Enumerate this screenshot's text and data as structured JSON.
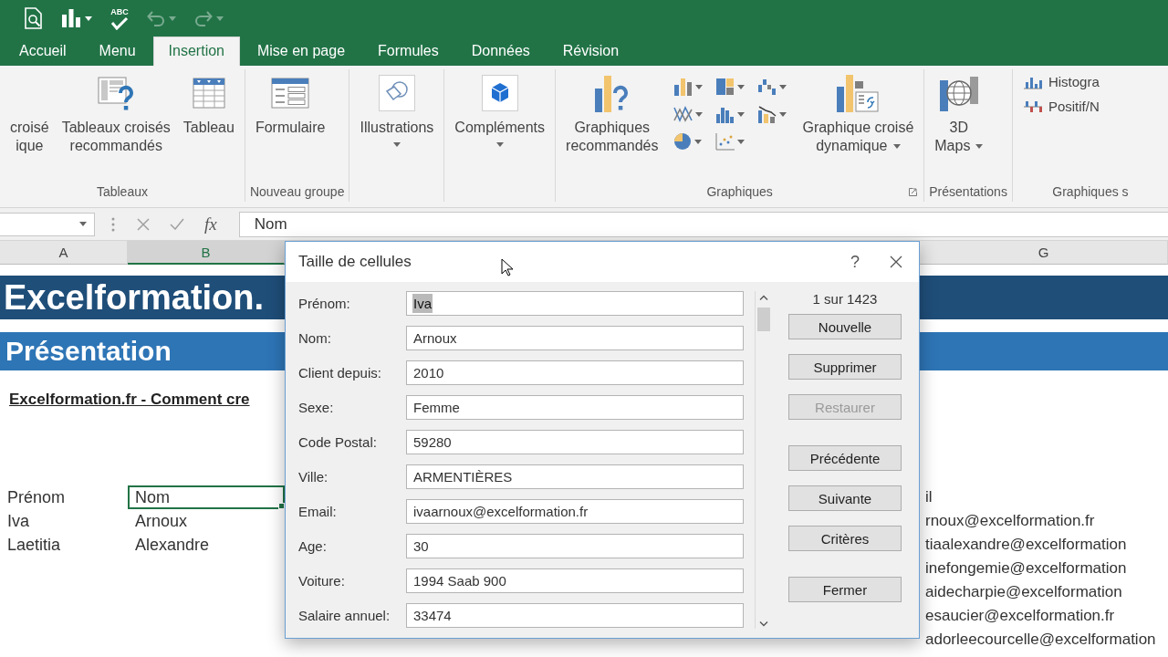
{
  "quick_access": [
    {
      "dropdown": false,
      "disabled": false
    },
    {
      "dropdown": true,
      "disabled": false
    },
    {
      "label": "ABC",
      "dropdown": false,
      "disabled": false
    },
    {
      "dropdown": true,
      "disabled": true
    },
    {
      "dropdown": true,
      "disabled": true
    }
  ],
  "tabs": [
    {
      "label": "Accueil",
      "selected": false
    },
    {
      "label": "Menu",
      "selected": false
    },
    {
      "label": "Insertion",
      "selected": true
    },
    {
      "label": "Mise en page",
      "selected": false
    },
    {
      "label": "Formules",
      "selected": false
    },
    {
      "label": "Données",
      "selected": false
    },
    {
      "label": "Révision",
      "selected": false
    }
  ],
  "ribbon": {
    "groups": [
      {
        "label": "Tableaux",
        "items": [
          {
            "kind": "large",
            "lines": [
              "croisé",
              "ique"
            ],
            "dropdown": false
          },
          {
            "kind": "large",
            "lines": [
              "Tableaux croisés",
              "recommandés"
            ],
            "dropdown": false
          },
          {
            "kind": "large",
            "lines": [
              "Tableau"
            ],
            "dropdown": false
          }
        ]
      },
      {
        "label": "Nouveau groupe",
        "items": [
          {
            "kind": "large",
            "lines": [
              "Formulaire"
            ],
            "dropdown": false
          }
        ]
      },
      {
        "items": [
          {
            "kind": "large",
            "lines": [
              "Illustrations"
            ],
            "dropdown": true
          }
        ]
      },
      {
        "items": [
          {
            "kind": "large",
            "lines": [
              "Compléments"
            ],
            "dropdown": true
          }
        ]
      },
      {
        "label": "Graphiques",
        "launcher": true,
        "items": [
          {
            "kind": "large",
            "lines": [
              "Graphiques",
              "recommandés"
            ],
            "dropdown": false
          },
          {
            "kind": "gallery",
            "items": [
              {
                "dropdown": true
              },
              {
                "dropdown": true
              },
              {
                "dropdown": true
              },
              {
                "dropdown": true
              },
              {
                "dropdown": true
              },
              {
                "dropdown": true
              },
              {
                "dropdown": true
              },
              {
                "dropdown": true
              }
            ]
          },
          {
            "kind": "large",
            "lines": [
              "Graphique croisé",
              "dynamique"
            ],
            "dropdown": true
          }
        ]
      },
      {
        "label": "Présentations",
        "items": [
          {
            "kind": "large",
            "lines": [
              "3D",
              "Maps"
            ],
            "dropdown": true
          }
        ]
      },
      {
        "label": "Graphiques s",
        "items": [
          {
            "kind": "stack",
            "items": [
              {
                "label": "Histogra"
              },
              {
                "label": "Positif/N"
              }
            ]
          }
        ]
      }
    ]
  },
  "formula_bar": {
    "function_label": "fx",
    "value": "Nom"
  },
  "sheet": {
    "columns": [
      {
        "label": "A",
        "selected": false
      },
      {
        "label": "B",
        "selected": true
      },
      {
        "label": "G",
        "selected": false
      }
    ],
    "title_banner": "Excelformation.",
    "section_banner": "Présentation",
    "subtitle": "Excelformation.fr - Comment cre",
    "rows": [
      {
        "column_a": {
          "text": "Prénom",
          "active": false
        },
        "column_b": {
          "text": "Nom",
          "active": true
        },
        "column_g": {
          "text": "il",
          "active": false
        }
      },
      {
        "column_a": {
          "text": "Iva",
          "active": false
        },
        "column_b": {
          "text": "Arnoux",
          "active": false
        },
        "column_g": {
          "text": "rnoux@excelformation.fr",
          "active": false
        }
      },
      {
        "column_a": {
          "text": "Laetitia",
          "active": false
        },
        "column_b": {
          "text": "Alexandre",
          "active": false
        },
        "column_g": {
          "text": "tiaalexandre@excelformation",
          "active": false
        }
      },
      {
        "column_g": {
          "text": "inefongemie@excelformation",
          "active": false
        }
      },
      {
        "column_g": {
          "text": "aidecharpie@excelformation",
          "active": false
        }
      },
      {
        "column_g": {
          "text": "esaucier@excelformation.fr",
          "active": false
        }
      },
      {
        "column_g": {
          "text": "adorleecourcelle@excelformation",
          "active": false
        }
      }
    ]
  },
  "dialog": {
    "title": "Taille de cellules",
    "help": "?",
    "counter": "1 sur 1423",
    "fields": [
      {
        "label": "Prénom:",
        "value": "Iva",
        "highlighted": true
      },
      {
        "label": "Nom:",
        "value": "Arnoux",
        "highlighted": false
      },
      {
        "label": "Client depuis:",
        "value": "2010",
        "highlighted": false
      },
      {
        "label": "Sexe:",
        "value": "Femme",
        "highlighted": false
      },
      {
        "label": "Code Postal:",
        "value": "59280",
        "highlighted": false
      },
      {
        "label": "Ville:",
        "value": "ARMENTIÈRES",
        "highlighted": false
      },
      {
        "label": "Email:",
        "value": "ivaarnoux@excelformation.fr",
        "highlighted": false
      },
      {
        "label": "Age:",
        "value": "30",
        "highlighted": false
      },
      {
        "label": "Voiture:",
        "value": "1994 Saab 900",
        "highlighted": false
      },
      {
        "label": "Salaire annuel:",
        "value": "33474",
        "highlighted": false
      }
    ],
    "buttons": [
      {
        "label": "Nouvelle",
        "disabled": false
      },
      {
        "label": "Supprimer",
        "disabled": false
      },
      {
        "label": "Restaurer",
        "disabled": true
      },
      {
        "label": "Précédente",
        "disabled": false
      },
      {
        "label": "Suivante",
        "disabled": false
      },
      {
        "label": "Critères",
        "disabled": false
      },
      {
        "label": "Fermer",
        "disabled": false
      }
    ]
  }
}
